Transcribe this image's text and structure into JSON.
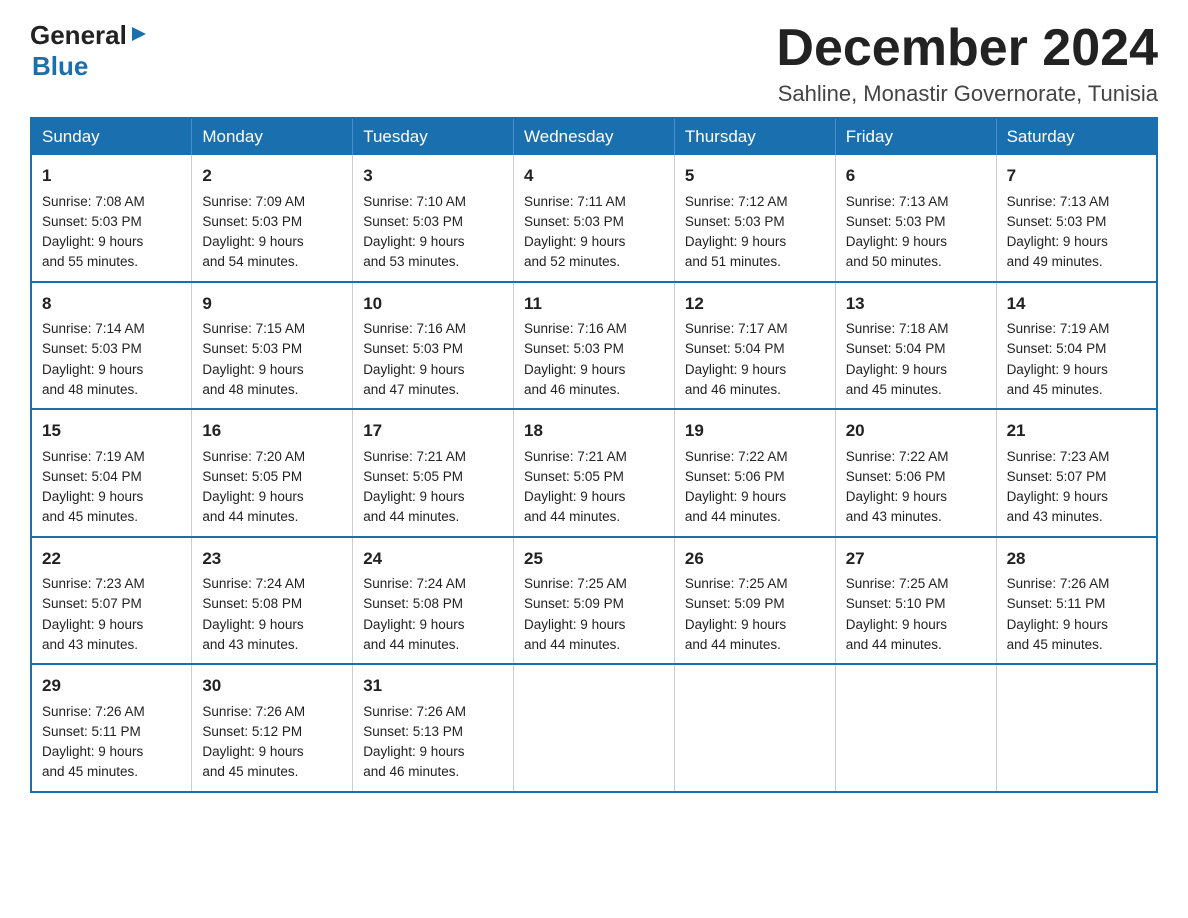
{
  "logo": {
    "text_general": "General",
    "text_blue": "Blue",
    "arrow": "▶"
  },
  "header": {
    "month_title": "December 2024",
    "location": "Sahline, Monastir Governorate, Tunisia"
  },
  "days_of_week": [
    "Sunday",
    "Monday",
    "Tuesday",
    "Wednesday",
    "Thursday",
    "Friday",
    "Saturday"
  ],
  "weeks": [
    [
      {
        "day": "1",
        "sunrise": "7:08 AM",
        "sunset": "5:03 PM",
        "daylight": "9 hours and 55 minutes."
      },
      {
        "day": "2",
        "sunrise": "7:09 AM",
        "sunset": "5:03 PM",
        "daylight": "9 hours and 54 minutes."
      },
      {
        "day": "3",
        "sunrise": "7:10 AM",
        "sunset": "5:03 PM",
        "daylight": "9 hours and 53 minutes."
      },
      {
        "day": "4",
        "sunrise": "7:11 AM",
        "sunset": "5:03 PM",
        "daylight": "9 hours and 52 minutes."
      },
      {
        "day": "5",
        "sunrise": "7:12 AM",
        "sunset": "5:03 PM",
        "daylight": "9 hours and 51 minutes."
      },
      {
        "day": "6",
        "sunrise": "7:13 AM",
        "sunset": "5:03 PM",
        "daylight": "9 hours and 50 minutes."
      },
      {
        "day": "7",
        "sunrise": "7:13 AM",
        "sunset": "5:03 PM",
        "daylight": "9 hours and 49 minutes."
      }
    ],
    [
      {
        "day": "8",
        "sunrise": "7:14 AM",
        "sunset": "5:03 PM",
        "daylight": "9 hours and 48 minutes."
      },
      {
        "day": "9",
        "sunrise": "7:15 AM",
        "sunset": "5:03 PM",
        "daylight": "9 hours and 48 minutes."
      },
      {
        "day": "10",
        "sunrise": "7:16 AM",
        "sunset": "5:03 PM",
        "daylight": "9 hours and 47 minutes."
      },
      {
        "day": "11",
        "sunrise": "7:16 AM",
        "sunset": "5:03 PM",
        "daylight": "9 hours and 46 minutes."
      },
      {
        "day": "12",
        "sunrise": "7:17 AM",
        "sunset": "5:04 PM",
        "daylight": "9 hours and 46 minutes."
      },
      {
        "day": "13",
        "sunrise": "7:18 AM",
        "sunset": "5:04 PM",
        "daylight": "9 hours and 45 minutes."
      },
      {
        "day": "14",
        "sunrise": "7:19 AM",
        "sunset": "5:04 PM",
        "daylight": "9 hours and 45 minutes."
      }
    ],
    [
      {
        "day": "15",
        "sunrise": "7:19 AM",
        "sunset": "5:04 PM",
        "daylight": "9 hours and 45 minutes."
      },
      {
        "day": "16",
        "sunrise": "7:20 AM",
        "sunset": "5:05 PM",
        "daylight": "9 hours and 44 minutes."
      },
      {
        "day": "17",
        "sunrise": "7:21 AM",
        "sunset": "5:05 PM",
        "daylight": "9 hours and 44 minutes."
      },
      {
        "day": "18",
        "sunrise": "7:21 AM",
        "sunset": "5:05 PM",
        "daylight": "9 hours and 44 minutes."
      },
      {
        "day": "19",
        "sunrise": "7:22 AM",
        "sunset": "5:06 PM",
        "daylight": "9 hours and 44 minutes."
      },
      {
        "day": "20",
        "sunrise": "7:22 AM",
        "sunset": "5:06 PM",
        "daylight": "9 hours and 43 minutes."
      },
      {
        "day": "21",
        "sunrise": "7:23 AM",
        "sunset": "5:07 PM",
        "daylight": "9 hours and 43 minutes."
      }
    ],
    [
      {
        "day": "22",
        "sunrise": "7:23 AM",
        "sunset": "5:07 PM",
        "daylight": "9 hours and 43 minutes."
      },
      {
        "day": "23",
        "sunrise": "7:24 AM",
        "sunset": "5:08 PM",
        "daylight": "9 hours and 43 minutes."
      },
      {
        "day": "24",
        "sunrise": "7:24 AM",
        "sunset": "5:08 PM",
        "daylight": "9 hours and 44 minutes."
      },
      {
        "day": "25",
        "sunrise": "7:25 AM",
        "sunset": "5:09 PM",
        "daylight": "9 hours and 44 minutes."
      },
      {
        "day": "26",
        "sunrise": "7:25 AM",
        "sunset": "5:09 PM",
        "daylight": "9 hours and 44 minutes."
      },
      {
        "day": "27",
        "sunrise": "7:25 AM",
        "sunset": "5:10 PM",
        "daylight": "9 hours and 44 minutes."
      },
      {
        "day": "28",
        "sunrise": "7:26 AM",
        "sunset": "5:11 PM",
        "daylight": "9 hours and 45 minutes."
      }
    ],
    [
      {
        "day": "29",
        "sunrise": "7:26 AM",
        "sunset": "5:11 PM",
        "daylight": "9 hours and 45 minutes."
      },
      {
        "day": "30",
        "sunrise": "7:26 AM",
        "sunset": "5:12 PM",
        "daylight": "9 hours and 45 minutes."
      },
      {
        "day": "31",
        "sunrise": "7:26 AM",
        "sunset": "5:13 PM",
        "daylight": "9 hours and 46 minutes."
      },
      null,
      null,
      null,
      null
    ]
  ],
  "labels": {
    "sunrise": "Sunrise:",
    "sunset": "Sunset:",
    "daylight": "Daylight:"
  }
}
